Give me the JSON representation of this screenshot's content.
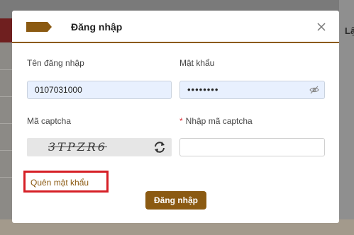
{
  "background": {
    "right_text": "Lậ"
  },
  "modal": {
    "title": "Đăng nhập",
    "close_icon": "close-icon"
  },
  "form": {
    "username_label": "Tên đăng nhập",
    "username_value": "0107031000",
    "password_label": "Mật khẩu",
    "password_value": "••••••••",
    "captcha_label": "Mã captcha",
    "captcha_text": "3TPZR6",
    "captcha_input_label": "Nhập mã captcha",
    "captcha_required_mark": "*",
    "captcha_input_value": "",
    "forgot_link": "Quên mật khẩu",
    "submit_label": "Đăng nhập"
  },
  "colors": {
    "accent": "#8b5a12",
    "highlight_border": "#d61f26",
    "input_fill": "#e8f0fe"
  }
}
